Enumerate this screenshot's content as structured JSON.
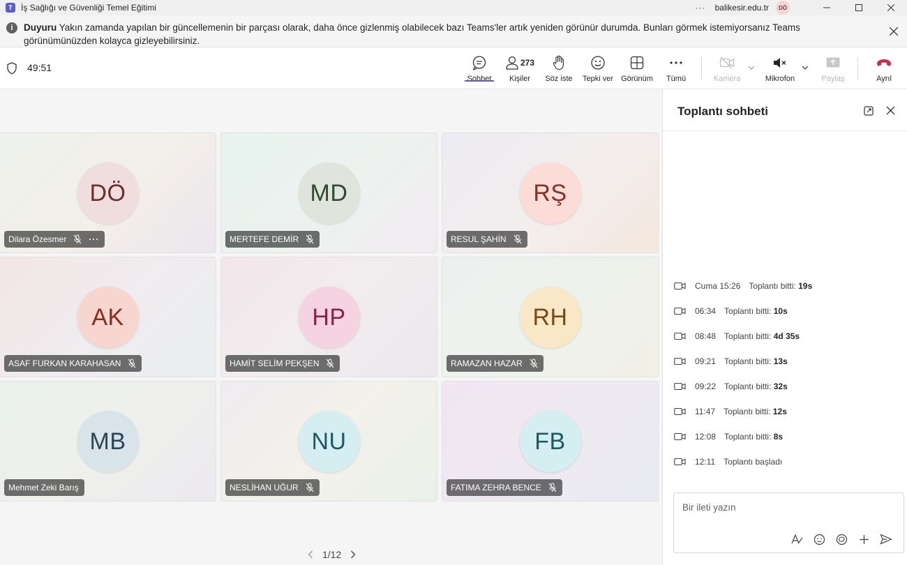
{
  "window": {
    "title": "İş Sağlığı ve Güvenliği Temel Eğitimi",
    "more": "···",
    "org": "balikesir.edu.tr",
    "user_initials": "DÖ"
  },
  "banner": {
    "label": "Duyuru",
    "message": "Yakın zamanda yapılan bir güncellemenin bir parçası olarak, daha önce gizlenmiş olabilecek bazı Teams'ler artık yeniden görünür durumda. Bunları görmek istemiyorsanız Teams görünümünüzden kolayca gizleyebilirsiniz."
  },
  "toolbar": {
    "timer": "49:51",
    "chat_label": "Sohbet",
    "people_label": "Kişiler",
    "people_count": "273",
    "raise_label": "Söz iste",
    "react_label": "Tepki ver",
    "view_label": "Görünüm",
    "more_label": "Tümü",
    "camera_label": "Kamera",
    "mic_label": "Mikrofon",
    "share_label": "Paylaş",
    "leave_label": "Ayrıl"
  },
  "participants": [
    {
      "initials": "DÖ",
      "name": "Dilara Özesmer",
      "muted": true,
      "more": true,
      "bg": "#f0dede",
      "fg": "#6b2f2f"
    },
    {
      "initials": "MD",
      "name": "MERTEFE DEMİR",
      "muted": true,
      "bg": "#dfe5dc",
      "fg": "#2f4a2f"
    },
    {
      "initials": "RŞ",
      "name": "RESUL ŞAHİN",
      "muted": true,
      "bg": "#fbdcd7",
      "fg": "#8a2f24"
    },
    {
      "initials": "AK",
      "name": "ASAF FURKAN KARAHASAN",
      "muted": true,
      "bg": "#f6d6cf",
      "fg": "#8a2a1c"
    },
    {
      "initials": "HP",
      "name": "HAMİT SELİM PEKŞEN",
      "muted": true,
      "bg": "#f6d3e0",
      "fg": "#8a1f47"
    },
    {
      "initials": "RH",
      "name": "RAMAZAN HAZAR",
      "muted": true,
      "bg": "#f9e8c6",
      "fg": "#7a4a14"
    },
    {
      "initials": "MB",
      "name": "Mehmet Zeki Barış",
      "muted": false,
      "bg": "#d8e3ea",
      "fg": "#2b4654"
    },
    {
      "initials": "NU",
      "name": "NESLİHAN UĞUR",
      "muted": true,
      "bg": "#d4eef1",
      "fg": "#1e5961"
    },
    {
      "initials": "FB",
      "name": "FATIMA ZEHRA BENCE",
      "muted": true,
      "bg": "#d4eef1",
      "fg": "#1e5961"
    }
  ],
  "pager": {
    "text": "1/12"
  },
  "chat": {
    "title": "Toplantı sohbeti",
    "messages": [
      {
        "time": "Cuma 15:26",
        "text": "Toplantı bitti:",
        "duration": "19s"
      },
      {
        "time": "06:34",
        "text": "Toplantı bitti:",
        "duration": "10s"
      },
      {
        "time": "08:48",
        "text": "Toplantı bitti:",
        "duration": "4d 35s"
      },
      {
        "time": "09:21",
        "text": "Toplantı bitti:",
        "duration": "13s"
      },
      {
        "time": "09:22",
        "text": "Toplantı bitti:",
        "duration": "32s"
      },
      {
        "time": "11:47",
        "text": "Toplantı bitti:",
        "duration": "12s"
      },
      {
        "time": "12:08",
        "text": "Toplantı bitti:",
        "duration": "8s"
      },
      {
        "time": "12:11",
        "text": "Toplantı başladı",
        "duration": ""
      }
    ],
    "compose_placeholder": "Bir ileti yazın"
  },
  "colors": {
    "accent": "#5b5fc7",
    "leave": "#c4314b"
  }
}
